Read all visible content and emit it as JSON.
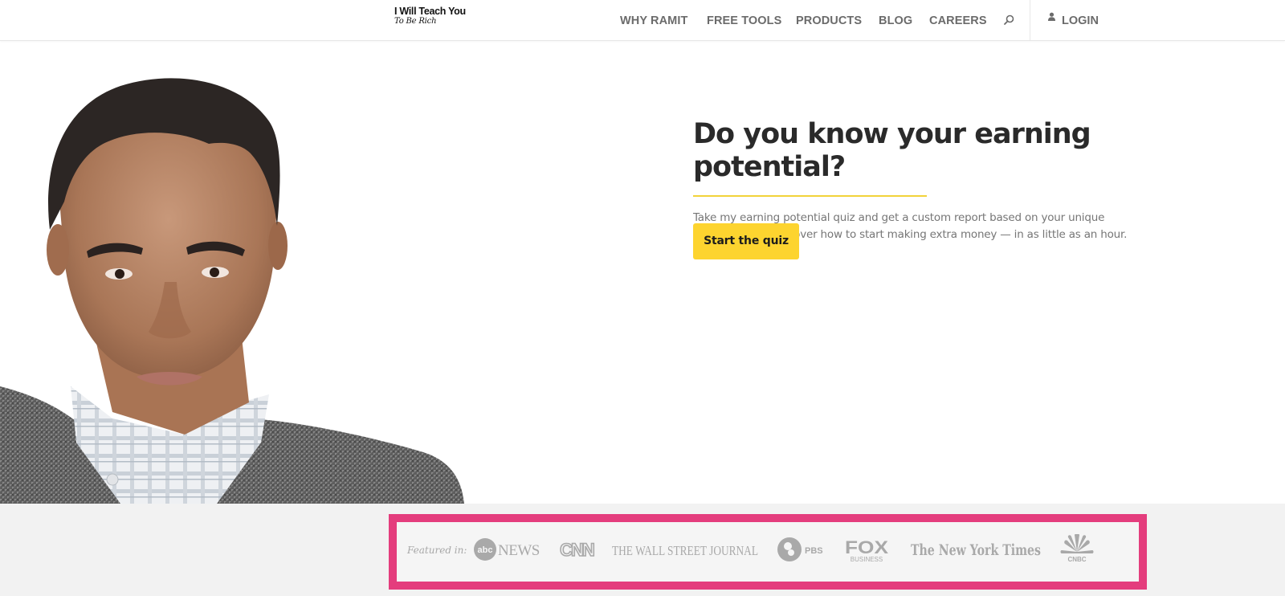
{
  "brand": {
    "line1": "I Will Teach You",
    "line2": "To Be Rich"
  },
  "nav": {
    "items": [
      {
        "label": "WHY RAMIT"
      },
      {
        "label": "FREE TOOLS"
      },
      {
        "label": "PRODUCTS"
      },
      {
        "label": "BLOG"
      },
      {
        "label": "CAREERS"
      }
    ],
    "search_icon": "search-icon",
    "login_label": "LOGIN",
    "login_icon": "user-icon"
  },
  "hero": {
    "headline": "Do you know your earning potential?",
    "subcopy": "Take my earning potential quiz and get a custom report based on your unique strengths, and discover how to start making extra money — in as little as an hour.",
    "cta_label": "Start the quiz"
  },
  "featured": {
    "label": "Featured in:",
    "outlets": [
      {
        "name": "abc NEWS",
        "abc": "abc",
        "news": "NEWS"
      },
      {
        "name": "CNN"
      },
      {
        "name": "THE WALL STREET JOURNAL"
      },
      {
        "name": "PBS"
      },
      {
        "name": "FOX BUSINESS",
        "fox": "FOX",
        "business": "BUSINESS"
      },
      {
        "name": "The New York Times"
      },
      {
        "name": "CNBC"
      }
    ]
  },
  "colors": {
    "accent_yellow": "#fdd42f",
    "rule_yellow": "#f2d33a",
    "highlight_pink": "#e43d7d",
    "nav_text": "#6b6b6b",
    "headline_text": "#2a2a2a"
  }
}
